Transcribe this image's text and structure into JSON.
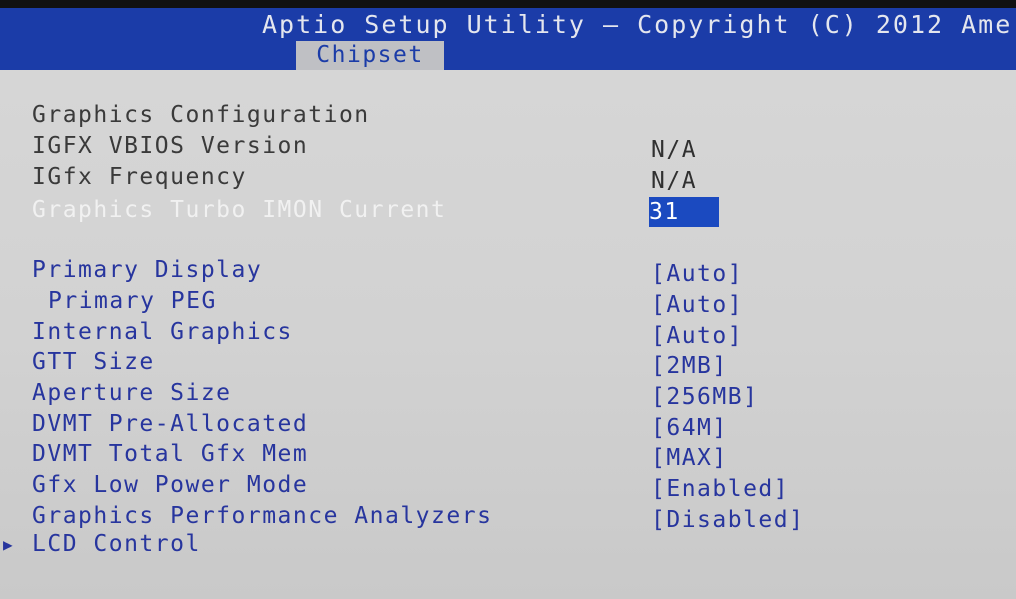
{
  "header": {
    "title": "Aptio Setup Utility – Copyright (C) 2012 Ame",
    "active_tab": "Chipset"
  },
  "section_title": "Graphics Configuration",
  "info_rows": [
    {
      "label": "IGFX VBIOS Version",
      "value": "N/A"
    },
    {
      "label": "IGfx Frequency",
      "value": "N/A"
    }
  ],
  "selected_row": {
    "label": "Graphics Turbo IMON Current",
    "value": "31"
  },
  "option_rows": [
    {
      "label": "Primary Display",
      "value": "[Auto]"
    },
    {
      "label": "Primary PEG",
      "value": "[Auto]"
    },
    {
      "label": "Internal Graphics",
      "value": "[Auto]"
    },
    {
      "label": "GTT Size",
      "value": "[2MB]"
    },
    {
      "label": "Aperture Size",
      "value": "[256MB]"
    },
    {
      "label": "DVMT Pre-Allocated",
      "value": "[64M]"
    },
    {
      "label": "DVMT Total Gfx Mem",
      "value": "[MAX]"
    },
    {
      "label": "Gfx Low Power Mode",
      "value": "[Enabled]"
    },
    {
      "label": "Graphics Performance Analyzers",
      "value": "[Disabled]"
    }
  ],
  "submenu": {
    "label": "LCD Control",
    "arrow": "▶"
  },
  "colors": {
    "header_bg": "#1b3ca8",
    "panel_bg": "#d3d3d3",
    "option_text": "#27359e",
    "static_text": "#3a3a3a",
    "highlight_bg": "#1b4ac0",
    "highlight_text": "#ffffff"
  }
}
